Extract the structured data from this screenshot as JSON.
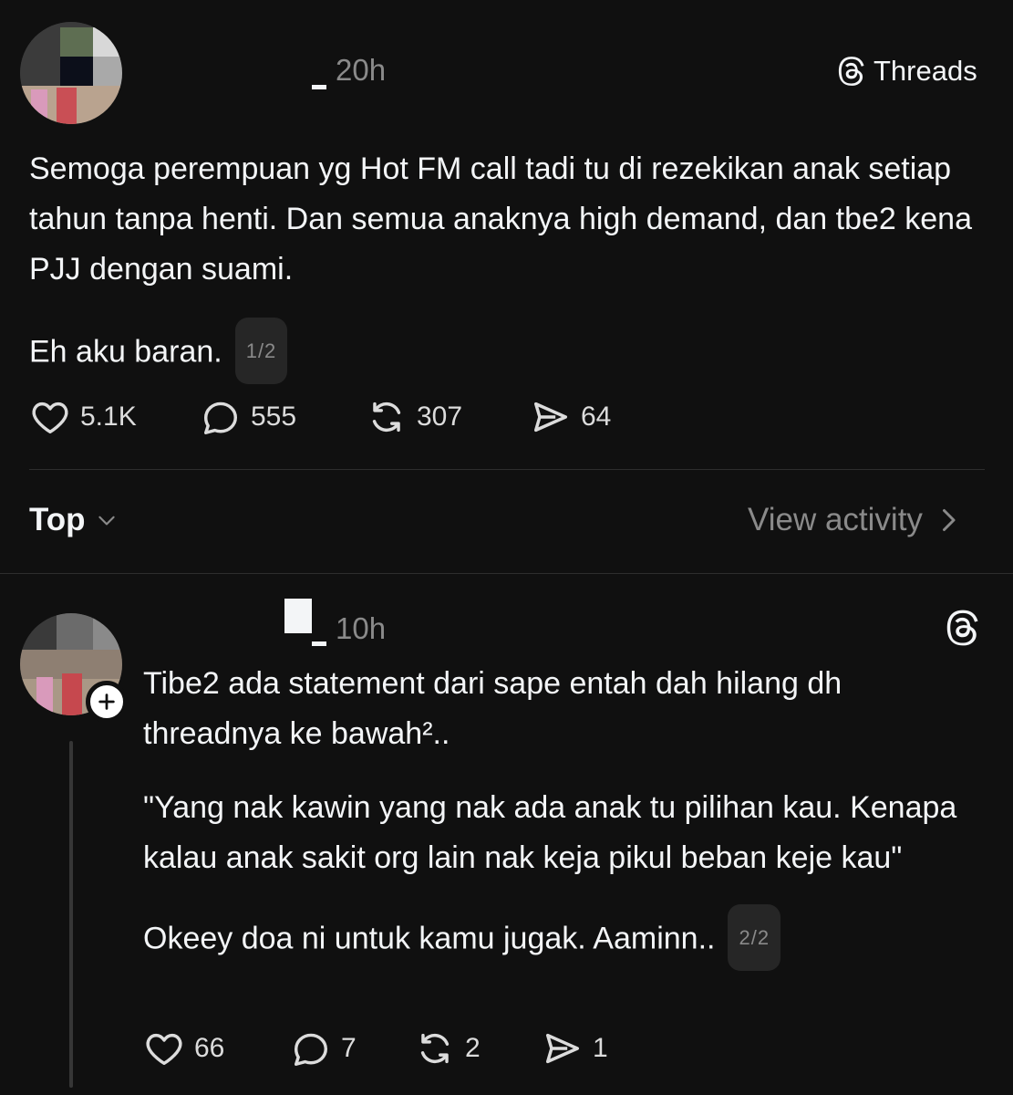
{
  "post1": {
    "time": "20h",
    "brand_label": "Threads",
    "paragraphs": [
      "Semoga perempuan yg Hot FM call tadi tu di rezekikan anak setiap tahun tanpa henti. Dan semua anaknya high demand, dan tbe2 kena PJJ dengan suami."
    ],
    "last_line": "Eh aku baran.",
    "pager": "1/2",
    "stats": {
      "likes": "5.1K",
      "replies": "555",
      "reposts": "307",
      "shares": "64"
    }
  },
  "filter": {
    "sort_label": "Top",
    "view_activity_label": "View activity"
  },
  "post2": {
    "time": "10h",
    "paragraphs": [
      "Tibe2 ada statement dari sape entah dah hilang dh threadnya ke bawah².."
    ],
    "quote": "\"Yang nak kawin yang nak ada anak tu pilihan kau. Kenapa kalau anak sakit org lain nak keja pikul beban keje kau\"",
    "last_line": "Okeey doa ni untuk kamu jugak. Aaminn..",
    "pager": "2/2",
    "stats": {
      "likes": "66",
      "replies": "7",
      "reposts": "2",
      "shares": "1"
    }
  },
  "icons": [
    "heart-icon",
    "comment-icon",
    "repost-icon",
    "share-icon",
    "threads-logo-icon",
    "chevron-down-icon",
    "chevron-right-icon",
    "plus-icon"
  ],
  "colors": {
    "background": "#101010",
    "text": "#f3f5f7",
    "muted": "#8a8a8a",
    "divider": "#2e2e2e"
  }
}
